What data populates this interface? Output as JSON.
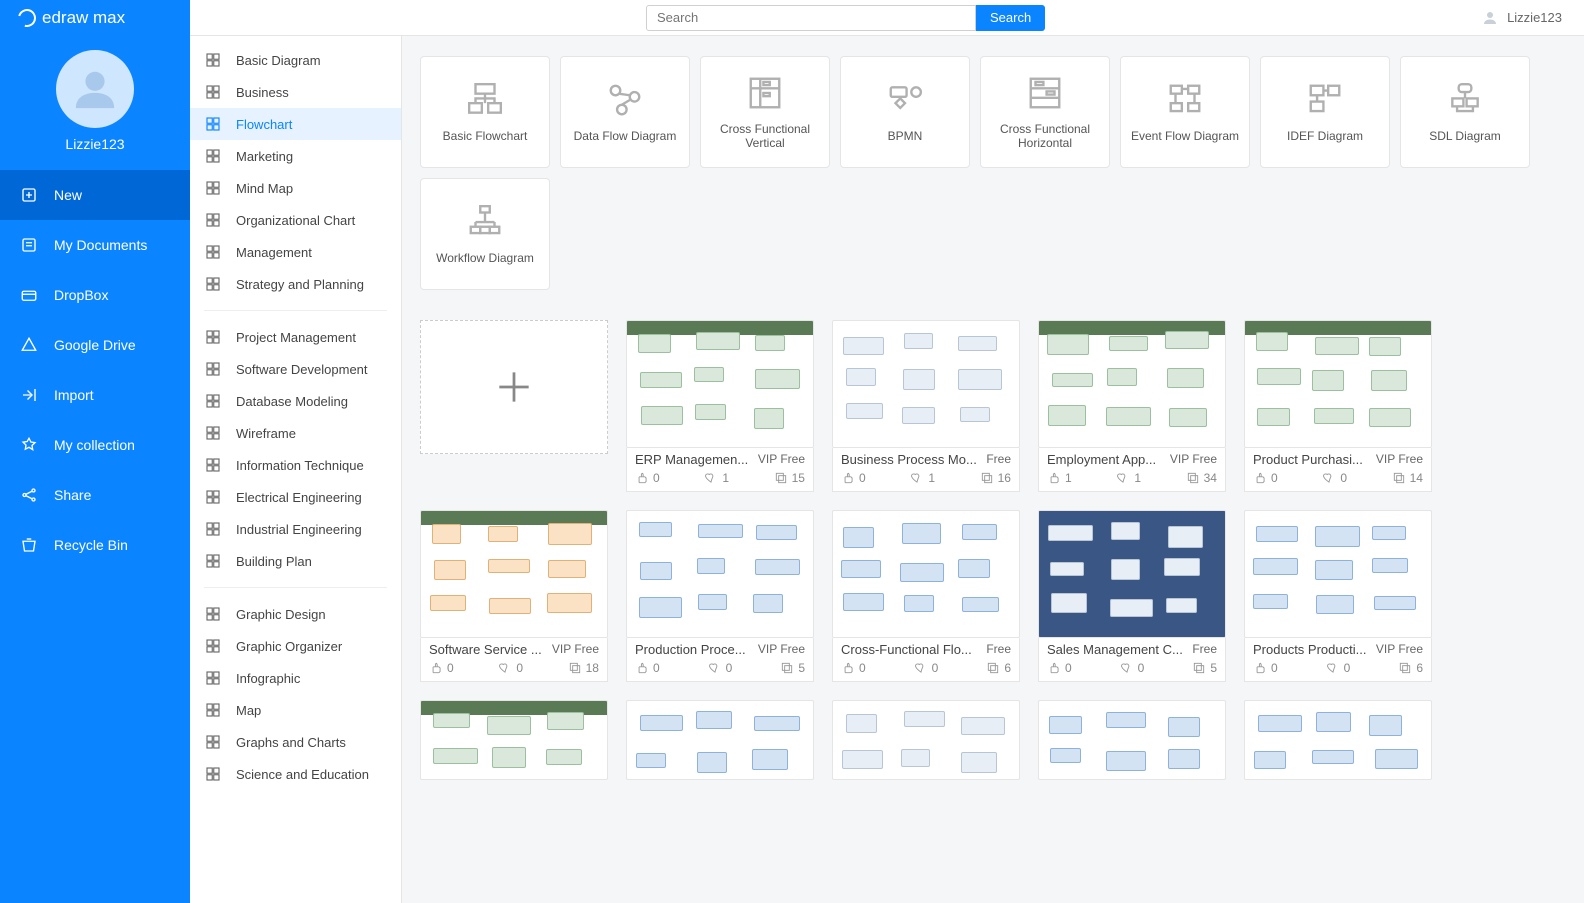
{
  "brand": "edraw max",
  "search": {
    "placeholder": "Search",
    "button": "Search"
  },
  "user": {
    "name": "Lizzie123"
  },
  "profile": {
    "name": "Lizzie123"
  },
  "nav": [
    {
      "label": "New",
      "active": true
    },
    {
      "label": "My Documents"
    },
    {
      "label": "DropBox"
    },
    {
      "label": "Google Drive"
    },
    {
      "label": "Import"
    },
    {
      "label": "My collection"
    },
    {
      "label": "Share"
    },
    {
      "label": "Recycle Bin"
    }
  ],
  "categories": {
    "group1": [
      "Basic Diagram",
      "Business",
      "Flowchart",
      "Marketing",
      "Mind Map",
      "Organizational Chart",
      "Management",
      "Strategy and Planning"
    ],
    "activeIndex": 2,
    "group2": [
      "Project Management",
      "Software Development",
      "Database Modeling",
      "Wireframe",
      "Information Technique",
      "Electrical Engineering",
      "Industrial Engineering",
      "Building Plan"
    ],
    "group3": [
      "Graphic Design",
      "Graphic Organizer",
      "Infographic",
      "Map",
      "Graphs and Charts",
      "Science and Education"
    ]
  },
  "types": [
    "Basic Flowchart",
    "Data Flow Diagram",
    "Cross Functional Vertical",
    "BPMN",
    "Cross Functional Horizontal",
    "Event Flow Diagram",
    "IDEF Diagram",
    "SDL Diagram",
    "Workflow Diagram"
  ],
  "templates": [
    {
      "title": "ERP Managemen...",
      "price": "VIP Free",
      "likes": 0,
      "favs": 1,
      "copies": 15,
      "style": "green"
    },
    {
      "title": "Business Process Mo...",
      "price": "Free",
      "likes": 0,
      "favs": 1,
      "copies": 16,
      "style": "plain"
    },
    {
      "title": "Employment App...",
      "price": "VIP Free",
      "likes": 1,
      "favs": 1,
      "copies": 34,
      "style": "green"
    },
    {
      "title": "Product Purchasi...",
      "price": "VIP Free",
      "likes": 0,
      "favs": 0,
      "copies": 14,
      "style": "green"
    },
    {
      "title": "Software Service ...",
      "price": "VIP Free",
      "likes": 0,
      "favs": 0,
      "copies": 18,
      "style": "orange"
    },
    {
      "title": "Production Proce...",
      "price": "VIP Free",
      "likes": 0,
      "favs": 0,
      "copies": 5,
      "style": "blue"
    },
    {
      "title": "Cross-Functional Flo...",
      "price": "Free",
      "likes": 0,
      "favs": 0,
      "copies": 6,
      "style": "blue"
    },
    {
      "title": "Sales Management C...",
      "price": "Free",
      "likes": 0,
      "favs": 0,
      "copies": 5,
      "style": "dark"
    },
    {
      "title": "Products Producti...",
      "price": "VIP Free",
      "likes": 0,
      "favs": 0,
      "copies": 6,
      "style": "blue"
    }
  ]
}
